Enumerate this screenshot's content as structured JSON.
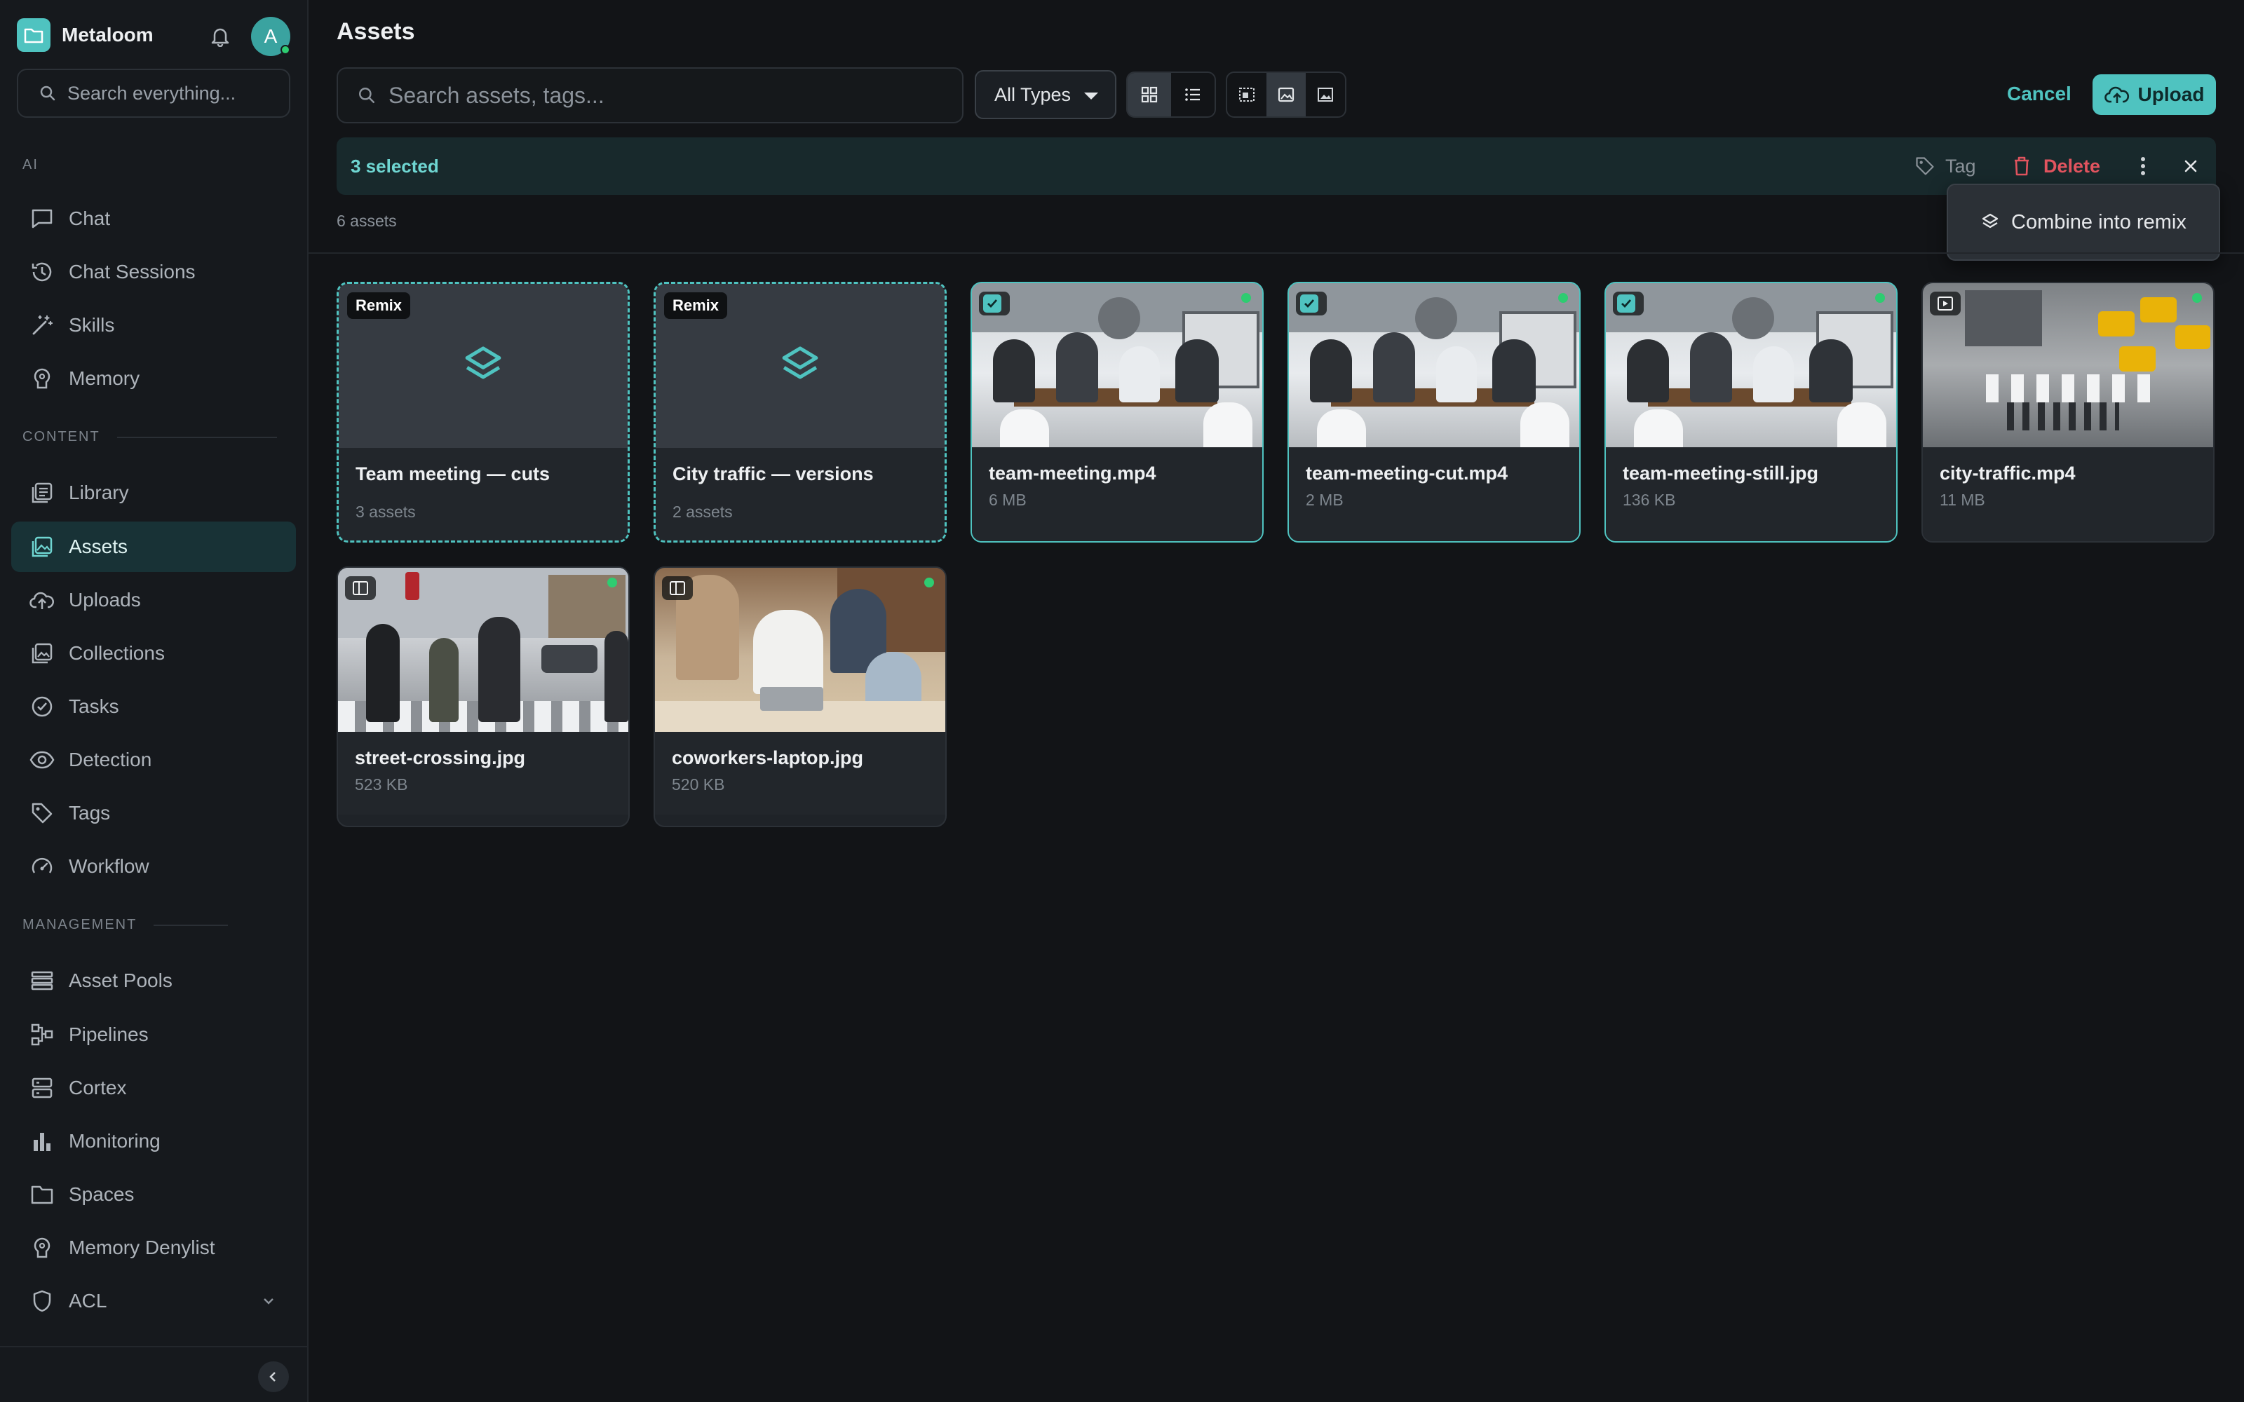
{
  "app": {
    "name": "Metaloom",
    "avatar_initial": "A",
    "search_placeholder": "Search everything..."
  },
  "sidebar": {
    "sections": {
      "ai": "AI",
      "content": "CONTENT",
      "management": "MANAGEMENT"
    },
    "items": [
      {
        "label": "Chat",
        "icon": "chat-icon"
      },
      {
        "label": "Chat Sessions",
        "icon": "history-icon"
      },
      {
        "label": "Skills",
        "icon": "wand-icon"
      },
      {
        "label": "Memory",
        "icon": "brain-icon"
      },
      {
        "label": "Library",
        "icon": "library-icon"
      },
      {
        "label": "Assets",
        "icon": "image-icon",
        "active": true
      },
      {
        "label": "Uploads",
        "icon": "cloud-upload-icon"
      },
      {
        "label": "Collections",
        "icon": "collections-icon"
      },
      {
        "label": "Tasks",
        "icon": "check-circle-icon"
      },
      {
        "label": "Detection",
        "icon": "eye-icon"
      },
      {
        "label": "Tags",
        "icon": "tag-icon"
      },
      {
        "label": "Workflow",
        "icon": "gauge-icon"
      },
      {
        "label": "Asset Pools",
        "icon": "stack-icon"
      },
      {
        "label": "Pipelines",
        "icon": "pipeline-icon"
      },
      {
        "label": "Cortex",
        "icon": "server-icon"
      },
      {
        "label": "Monitoring",
        "icon": "bar-chart-icon"
      },
      {
        "label": "Spaces",
        "icon": "folder-icon"
      },
      {
        "label": "Memory Denylist",
        "icon": "brain-icon"
      },
      {
        "label": "ACL",
        "icon": "shield-icon"
      }
    ]
  },
  "main": {
    "title": "Assets",
    "search_placeholder": "Search assets, tags...",
    "type_filter": "All Types",
    "cancel_label": "Cancel",
    "upload_label": "Upload",
    "selection": {
      "count_label": "3 selected",
      "tag_label": "Tag",
      "delete_label": "Delete"
    },
    "menu": {
      "combine_label": "Combine into remix"
    },
    "asset_count": "6 assets",
    "cards": [
      {
        "name": "Team meeting — cuts",
        "sub": "3 assets",
        "badge": "Remix",
        "kind": "remix"
      },
      {
        "name": "City traffic — versions",
        "sub": "2 assets",
        "badge": "Remix",
        "kind": "remix"
      },
      {
        "name": "team-meeting.mp4",
        "sub": "6 MB",
        "kind": "selected"
      },
      {
        "name": "team-meeting-cut.mp4",
        "sub": "2 MB",
        "kind": "selected"
      },
      {
        "name": "team-meeting-still.jpg",
        "sub": "136 KB",
        "kind": "selected"
      },
      {
        "name": "city-traffic.mp4",
        "sub": "11 MB",
        "kind": "normal"
      },
      {
        "name": "street-crossing.jpg",
        "sub": "523 KB",
        "kind": "normal"
      },
      {
        "name": "coworkers-laptop.jpg",
        "sub": "520 KB",
        "kind": "normal"
      }
    ]
  },
  "colors": {
    "accent": "#4fc3c0",
    "danger": "#e2545f",
    "background": "#121417",
    "status_green": "#2ecc71"
  }
}
